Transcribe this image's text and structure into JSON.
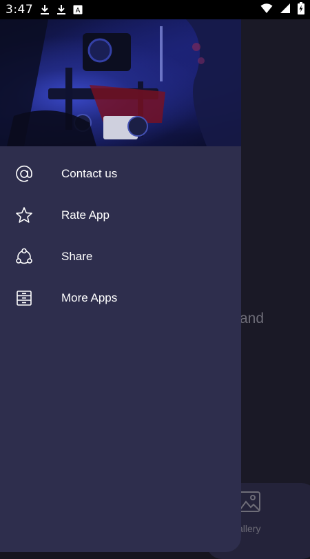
{
  "status_bar": {
    "time": "3:47",
    "left_icons": [
      "download-icon",
      "download-icon",
      "keyboard-icon"
    ],
    "right_icons": [
      "wifi-icon",
      "signal-icon",
      "battery-charging-icon"
    ]
  },
  "background": {
    "partial_text": "and",
    "nav_partial_label": "allery",
    "nav_icon": "gallery-icon"
  },
  "drawer": {
    "header_image": "camera-rig-image",
    "menu": [
      {
        "id": "contact",
        "label": "Contact us",
        "icon": "at-icon"
      },
      {
        "id": "rate",
        "label": "Rate App",
        "icon": "star-icon"
      },
      {
        "id": "share",
        "label": "Share",
        "icon": "share-icon"
      },
      {
        "id": "more",
        "label": "More Apps",
        "icon": "archive-icon"
      }
    ]
  },
  "colors": {
    "drawer_bg": "#2e2e4d",
    "app_bg": "#1a1926",
    "status_bar_bg": "#000000",
    "text_primary": "#ffffff",
    "text_muted": "#6e6d78"
  }
}
